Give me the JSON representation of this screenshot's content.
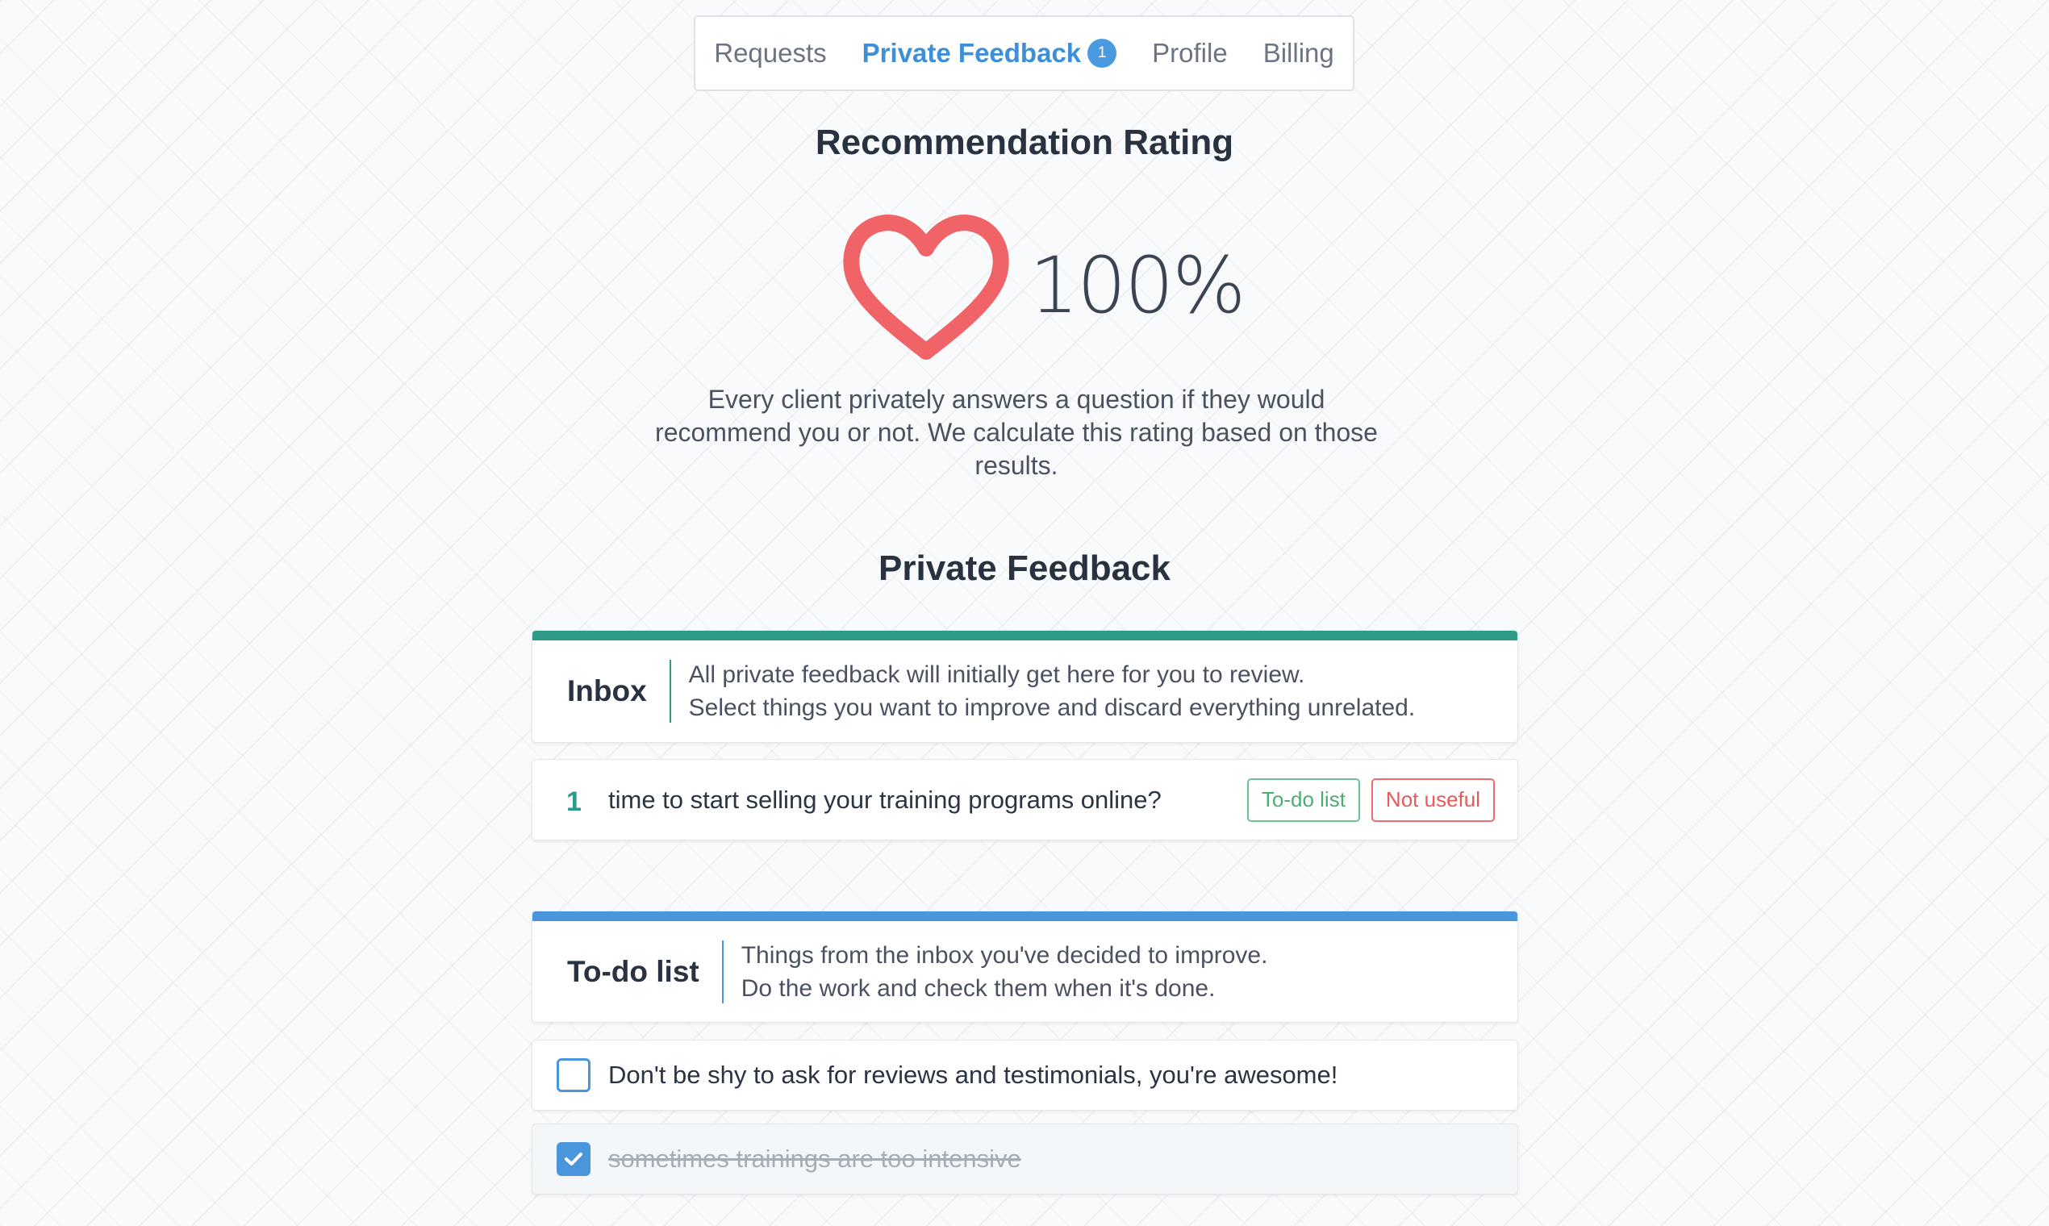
{
  "nav": {
    "items": [
      {
        "label": "Requests"
      },
      {
        "label": "Private Feedback",
        "badge": "1"
      },
      {
        "label": "Profile"
      },
      {
        "label": "Billing"
      }
    ]
  },
  "rating": {
    "title": "Recommendation Rating",
    "value": "100%",
    "icon": "heart-icon",
    "description": "Every client privately answers a question if they would recommend you or not. We calculate this rating based on those results."
  },
  "feedback": {
    "title": "Private Feedback",
    "inbox": {
      "title": "Inbox",
      "line1": "All private feedback will initially get here for you to review.",
      "line2": "Select things you want to improve and discard everything unrelated.",
      "items": [
        {
          "number": "1",
          "text": "time to start selling your training programs online?",
          "todo_label": "To-do list",
          "not_useful_label": "Not useful"
        }
      ]
    },
    "todo": {
      "title": "To-do list",
      "line1": "Things from the inbox you've decided to improve.",
      "line2": "Do the work and check them when it's done.",
      "items": [
        {
          "text": "Don't be shy to ask for reviews and testimonials, you're awesome!",
          "checked": false
        },
        {
          "text": "sometimes trainings are too intensive",
          "checked": true
        }
      ]
    }
  },
  "colors": {
    "accent_blue": "#4a96dc",
    "accent_teal": "#2f9a88",
    "heart": "#f06468",
    "success": "#4cae74",
    "danger": "#e55a5a"
  }
}
